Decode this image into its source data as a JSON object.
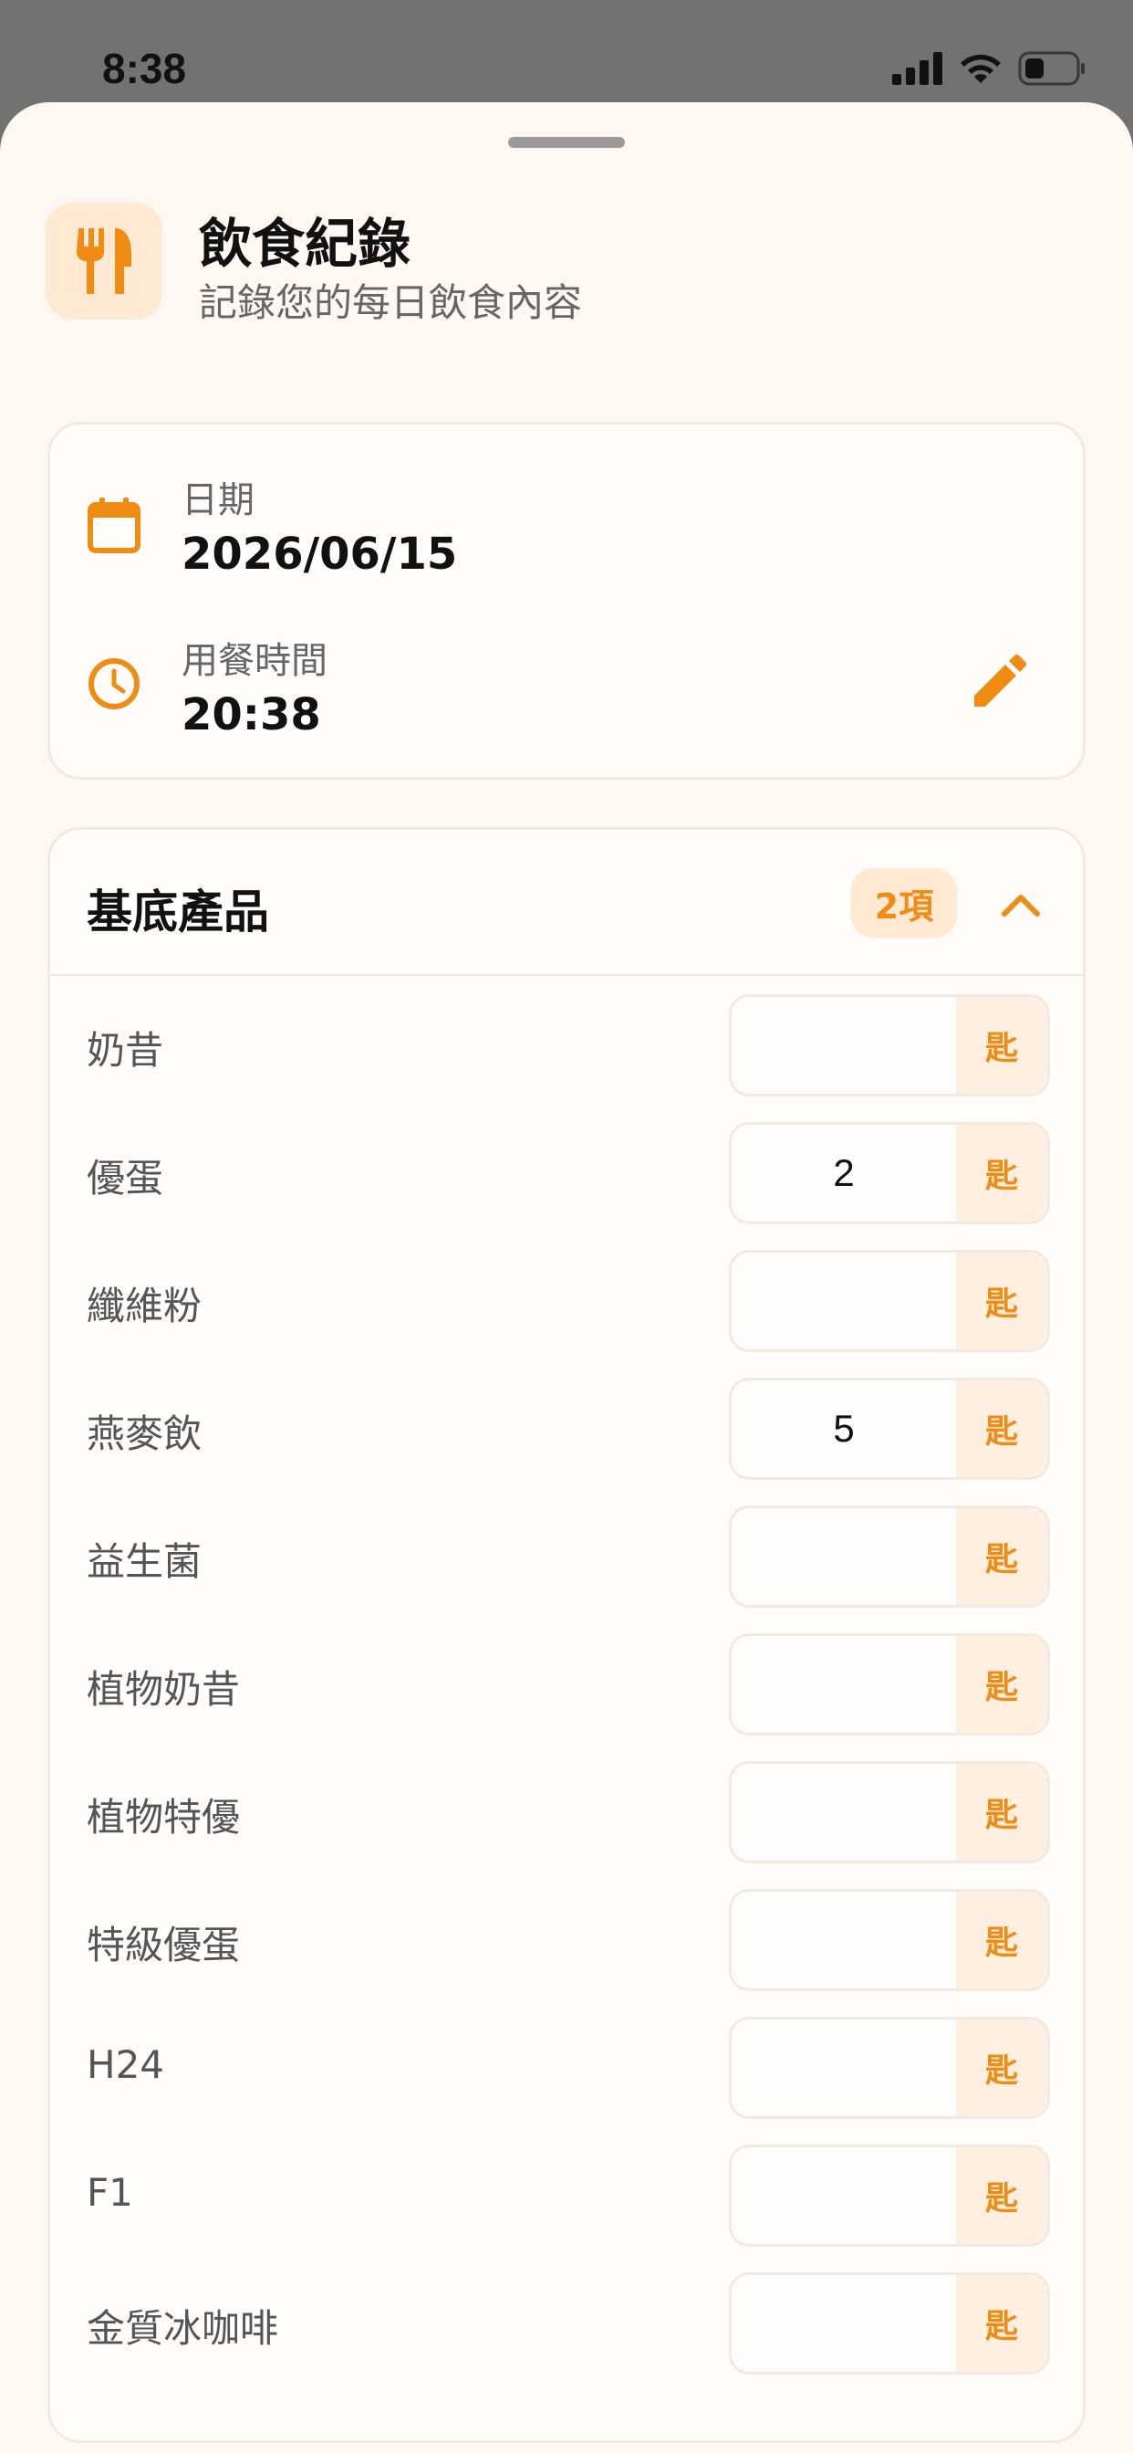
{
  "status_bar": {
    "time": "8:38"
  },
  "header": {
    "title": "飲食紀錄",
    "subtitle": "記錄您的每日飲食內容",
    "icon": "utensils-icon"
  },
  "datetime": {
    "date_label": "日期",
    "date_value": "2026/06/15",
    "time_label": "用餐時間",
    "time_value": "20:38"
  },
  "products": {
    "title": "基底產品",
    "count_badge": "2項",
    "unit": "匙",
    "items": [
      {
        "name": "奶昔",
        "qty": ""
      },
      {
        "name": "優蛋",
        "qty": "2"
      },
      {
        "name": "纖維粉",
        "qty": ""
      },
      {
        "name": "燕麥飲",
        "qty": "5"
      },
      {
        "name": "益生菌",
        "qty": ""
      },
      {
        "name": "植物奶昔",
        "qty": ""
      },
      {
        "name": "植物特優",
        "qty": ""
      },
      {
        "name": "特級優蛋",
        "qty": ""
      },
      {
        "name": "H24",
        "qty": ""
      },
      {
        "name": "F1",
        "qty": ""
      },
      {
        "name": "金質冰咖啡",
        "qty": ""
      }
    ]
  },
  "colors": {
    "accent": "#F08C14",
    "background": "#FFF8F2"
  }
}
